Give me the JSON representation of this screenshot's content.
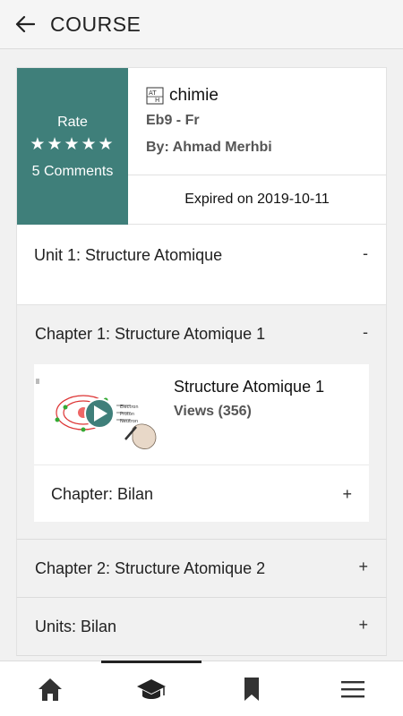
{
  "header": {
    "title": "COURSE",
    "back_icon": "arrow-left-icon"
  },
  "course": {
    "rate_label": "Rate",
    "stars": "★★★★★",
    "comments": "5 Comments",
    "subject": "chimie",
    "grade": "Eb9 - Fr",
    "author": "By: Ahmad Merhbi",
    "expiry": "Expired on 2019-10-11",
    "accent_color": "#3f7f7a"
  },
  "units": [
    {
      "label": "Unit 1: Structure Atomique",
      "toggle": "-",
      "chapters": [
        {
          "label": "Chapter 1: Structure Atomique 1",
          "toggle": "-",
          "lesson": {
            "title": "Structure Atomique 1",
            "views": "Views (356)"
          },
          "bilan": {
            "label": "Chapter: Bilan",
            "toggle": "+"
          }
        },
        {
          "label": "Chapter 2: Structure Atomique 2",
          "toggle": "+"
        }
      ],
      "bilan": {
        "label": "Units: Bilan",
        "toggle": "+"
      }
    }
  ],
  "tabbar": {
    "tabs": [
      {
        "name": "home-icon",
        "active": false
      },
      {
        "name": "graduation-cap-icon",
        "active": true
      },
      {
        "name": "bookmark-icon",
        "active": false
      },
      {
        "name": "menu-icon",
        "active": false
      }
    ]
  }
}
